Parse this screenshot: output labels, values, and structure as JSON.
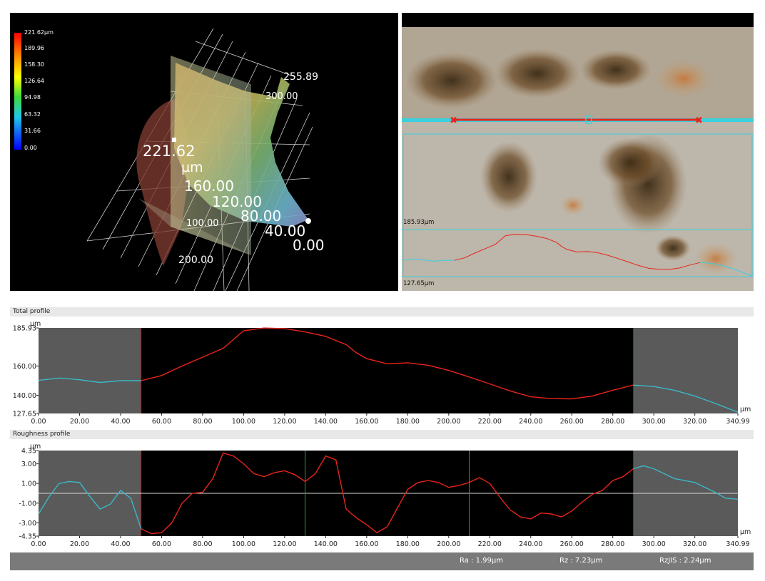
{
  "view3d": {
    "scale_values": [
      "221.62µm",
      "189.96",
      "158.30",
      "126.64",
      "94.98",
      "63.32",
      "31.66",
      "0.00"
    ],
    "axis_labels": {
      "top_right": "255.89",
      "top_right2": "300.00",
      "z_max": "221.62",
      "z_unit": "µm",
      "z_160": "160.00",
      "z_120": "120.00",
      "z_80": "80.00",
      "z_40": "40.00",
      "z_0": "0.00",
      "x_100": "100.00",
      "x_200": "200.00"
    },
    "colors": {
      "line_marker": "#e8241c",
      "cyan_band": "#39d0e0"
    }
  },
  "camera": {
    "upper_label": "185.93µm",
    "lower_label": "127.65µm"
  },
  "total_profile": {
    "title": "Total profile",
    "unit": "µm",
    "x_unit": "µm",
    "y_ticks": [
      "185.93",
      "160.00",
      "140.00",
      "127.65"
    ],
    "x_ticks": [
      "0.00",
      "20.00",
      "40.00",
      "60.00",
      "80.00",
      "100.00",
      "120.00",
      "140.00",
      "160.00",
      "180.00",
      "200.00",
      "220.00",
      "240.00",
      "260.00",
      "280.00",
      "300.00",
      "320.00",
      "340.99"
    ]
  },
  "roughness_profile": {
    "title": "Roughness profile",
    "unit": "µm",
    "x_unit": "µm",
    "y_ticks": [
      "4.35",
      "3.00",
      "1.00",
      "-1.00",
      "-3.00",
      "-4.35"
    ],
    "x_ticks": [
      "0.00",
      "20.00",
      "40.00",
      "60.00",
      "80.00",
      "100.00",
      "120.00",
      "140.00",
      "160.00",
      "180.00",
      "200.00",
      "220.00",
      "240.00",
      "260.00",
      "280.00",
      "300.00",
      "320.00",
      "340.99"
    ]
  },
  "status": {
    "ra": "Ra : 1.99µm",
    "rz": "Rz : 7.23µm",
    "rzjis": "RzJIS : 2.24µm"
  },
  "chart_data": [
    {
      "type": "line",
      "title": "Total profile",
      "xlabel": "µm",
      "ylabel": "µm",
      "xlim": [
        0,
        340.99
      ],
      "ylim": [
        127.65,
        185.93
      ],
      "evaluation_range": [
        50,
        290
      ],
      "series": [
        {
          "x": [
            0,
            10,
            20,
            30,
            40,
            50,
            60,
            70,
            80,
            90,
            100,
            110,
            120,
            130,
            140,
            150,
            155,
            160,
            170,
            180,
            190,
            200,
            210,
            220,
            230,
            240,
            250,
            260,
            270,
            280,
            290,
            300,
            310,
            320,
            330,
            340.99
          ],
          "y": [
            150.2,
            151.8,
            150.6,
            148.8,
            150.0,
            150.0,
            153.5,
            160.0,
            166.0,
            172.0,
            184.0,
            185.9,
            185.5,
            183.2,
            180.2,
            174.5,
            169.0,
            165.0,
            161.5,
            162.2,
            160.5,
            157.0,
            152.5,
            147.8,
            143.0,
            139.0,
            137.8,
            137.6,
            139.5,
            143.5,
            147.0,
            146.0,
            143.5,
            139.5,
            134.5,
            128.5
          ]
        }
      ]
    },
    {
      "type": "line",
      "title": "Roughness profile",
      "xlabel": "µm",
      "ylabel": "µm",
      "xlim": [
        0,
        340.99
      ],
      "ylim": [
        -4.35,
        4.35
      ],
      "evaluation_range": [
        50,
        290
      ],
      "series": [
        {
          "x": [
            0,
            5,
            10,
            15,
            20,
            25,
            30,
            35,
            40,
            45,
            50,
            55,
            60,
            65,
            70,
            75,
            80,
            85,
            90,
            95,
            100,
            105,
            110,
            115,
            120,
            125,
            130,
            135,
            140,
            145,
            150,
            155,
            160,
            165,
            170,
            175,
            180,
            185,
            190,
            195,
            200,
            205,
            210,
            215,
            220,
            225,
            230,
            235,
            240,
            245,
            250,
            255,
            260,
            265,
            270,
            275,
            280,
            285,
            290,
            295,
            300,
            305,
            310,
            315,
            320,
            325,
            330,
            335,
            340.99
          ],
          "y": [
            -2.1,
            -0.4,
            1.0,
            1.2,
            1.1,
            -0.3,
            -1.6,
            -1.1,
            0.3,
            -0.5,
            -3.6,
            -4.1,
            -4.0,
            -3.0,
            -1.0,
            0.0,
            0.1,
            1.5,
            4.1,
            3.8,
            3.0,
            2.0,
            1.7,
            2.1,
            2.3,
            1.9,
            1.2,
            2.0,
            3.8,
            3.4,
            -1.6,
            -2.5,
            -3.2,
            -4.0,
            -3.4,
            -1.5,
            0.4,
            1.1,
            1.3,
            1.1,
            0.6,
            0.8,
            1.1,
            1.6,
            1.0,
            -0.4,
            -1.7,
            -2.4,
            -2.6,
            -2.0,
            -2.1,
            -2.4,
            -1.8,
            -0.9,
            -0.1,
            0.3,
            1.3,
            1.7,
            2.5,
            2.8,
            2.5,
            2.0,
            1.5,
            1.3,
            1.1,
            0.6,
            0.1,
            -0.5,
            -0.6
          ]
        }
      ]
    }
  ]
}
